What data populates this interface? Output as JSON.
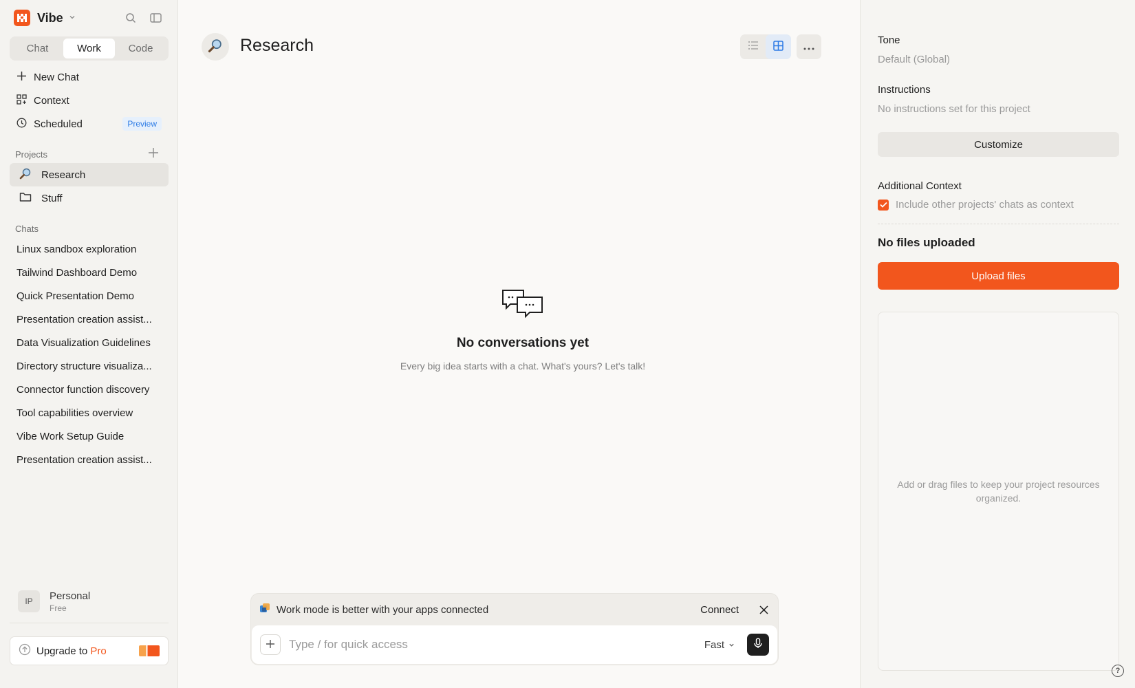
{
  "app": {
    "name": "Vibe"
  },
  "modes": [
    {
      "label": "Chat",
      "active": false
    },
    {
      "label": "Work",
      "active": true
    },
    {
      "label": "Code",
      "active": false
    }
  ],
  "nav": {
    "new_chat": "New Chat",
    "context": "Context",
    "scheduled": "Scheduled",
    "scheduled_badge": "Preview"
  },
  "projects": {
    "heading": "Projects",
    "items": [
      {
        "label": "Research",
        "icon": "magnifier-icon",
        "selected": true
      },
      {
        "label": "Stuff",
        "icon": "folder-icon",
        "selected": false
      }
    ]
  },
  "chats": {
    "heading": "Chats",
    "items": [
      "Linux sandbox exploration",
      "Tailwind Dashboard Demo",
      "Quick Presentation Demo",
      "Presentation creation assist...",
      "Data Visualization Guidelines",
      "Directory structure visualiza...",
      "Connector function discovery",
      "Tool capabilities overview",
      "Vibe Work Setup Guide",
      "Presentation creation assist..."
    ]
  },
  "account": {
    "initials": "IP",
    "name": "Personal",
    "plan": "Free"
  },
  "upgrade": {
    "prefix": "Upgrade to ",
    "highlight": "Pro"
  },
  "main": {
    "title": "Research",
    "view_mode": "grid",
    "empty_title": "No conversations yet",
    "empty_subtitle": "Every big idea starts with a chat. What's yours? Let's talk!"
  },
  "composer": {
    "banner_text": "Work mode is better with your apps connected",
    "connect_label": "Connect",
    "placeholder": "Type / for quick access",
    "model": "Fast"
  },
  "panel": {
    "tone_label": "Tone",
    "tone_value": "Default (Global)",
    "instructions_label": "Instructions",
    "instructions_value": "No instructions set for this project",
    "customize_label": "Customize",
    "additional_context_label": "Additional Context",
    "include_context_label": "Include other projects' chats as context",
    "include_context_checked": true,
    "files_heading": "No files uploaded",
    "upload_label": "Upload files",
    "drop_text": "Add or drag files to keep your project resources organized."
  },
  "colors": {
    "accent": "#f2561d",
    "badge_blue": "#2c7be5"
  }
}
